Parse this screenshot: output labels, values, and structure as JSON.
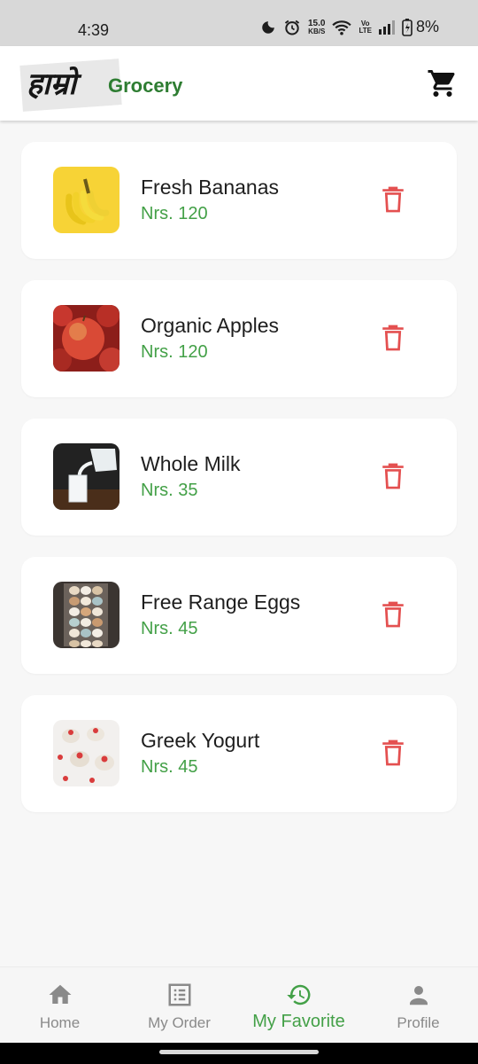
{
  "status_bar": {
    "time": "4:39",
    "net_speed_value": "15.0",
    "net_speed_unit": "KB/S",
    "volte_top": "Vo",
    "volte_bottom": "LTE",
    "battery": "8%"
  },
  "app_bar": {
    "logo_text": "Grocery",
    "logo_deva": "हाम्रो",
    "cart_icon": "cart-icon"
  },
  "favorites": [
    {
      "name": "Fresh Bananas",
      "price": "Nrs. 120",
      "image": "banana"
    },
    {
      "name": "Organic Apples",
      "price": "Nrs. 120",
      "image": "apples"
    },
    {
      "name": "Whole Milk",
      "price": "Nrs. 35",
      "image": "milk"
    },
    {
      "name": "Free Range Eggs",
      "price": "Nrs. 45",
      "image": "eggs"
    },
    {
      "name": "Greek Yogurt",
      "price": "Nrs. 45",
      "image": "yogurt"
    }
  ],
  "bottom_nav": [
    {
      "label": "Home",
      "icon": "home-icon",
      "active": false
    },
    {
      "label": "My Order",
      "icon": "list-icon",
      "active": false
    },
    {
      "label": "My Favorite",
      "icon": "history-icon",
      "active": true
    },
    {
      "label": "Profile",
      "icon": "person-icon",
      "active": false
    }
  ],
  "colors": {
    "accent": "#43a047",
    "delete": "#e45050",
    "brand_green": "#2e7d32"
  }
}
